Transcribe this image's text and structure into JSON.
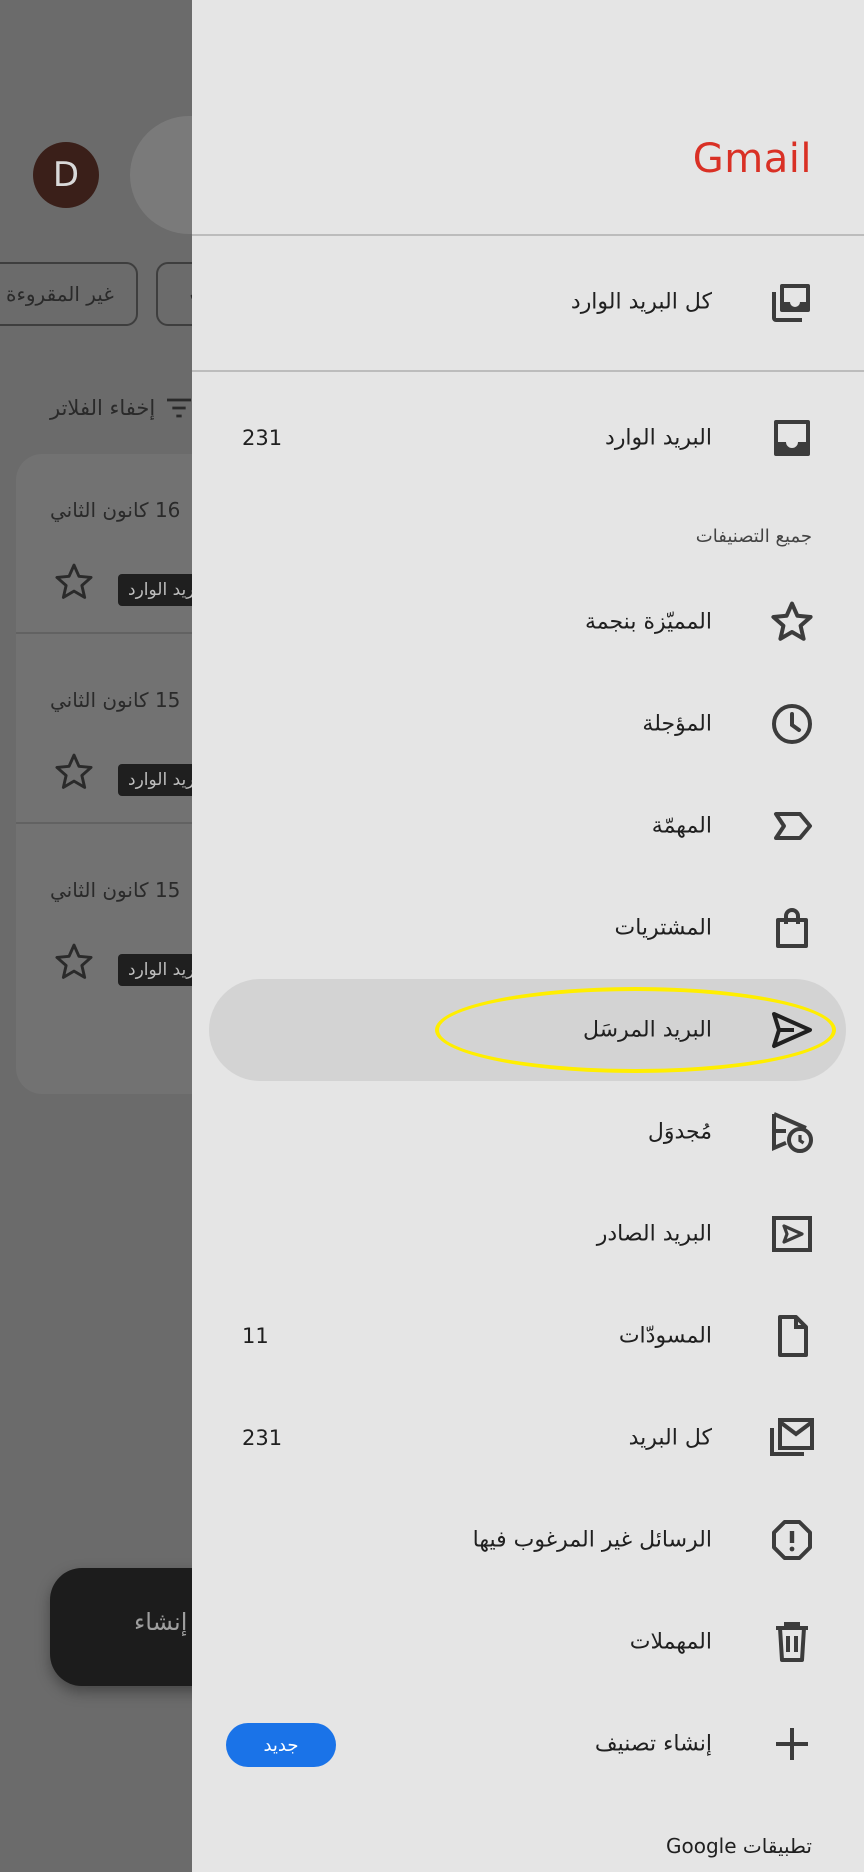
{
  "background": {
    "avatar_letter": "D",
    "chips": [
      "غير المقروءة",
      "✓"
    ],
    "filters_label": "إخفاء الفلاتر",
    "emails": [
      {
        "date": "16 كانون الثاني",
        "label": "البريد الوارد"
      },
      {
        "date": "15 كانون الثاني",
        "label": "البريد الوارد"
      },
      {
        "date": "15 كانون الثاني",
        "label": "البريد الوارد"
      }
    ],
    "compose_label": "إنشاء"
  },
  "drawer": {
    "logo": "Gmail",
    "all_inboxes": {
      "label": "كل البريد الوارد",
      "icon": "all-inboxes-icon"
    },
    "inbox": {
      "label": "البريد الوارد",
      "count": "231",
      "icon": "inbox-icon"
    },
    "section_title": "جميع التصنيفات",
    "items": [
      {
        "label": "المميّزة بنجمة",
        "count": "",
        "icon": "star-icon"
      },
      {
        "label": "المؤجلة",
        "count": "",
        "icon": "clock-icon"
      },
      {
        "label": "المهمّة",
        "count": "",
        "icon": "important-icon"
      },
      {
        "label": "المشتريات",
        "count": "",
        "icon": "shopping-bag-icon"
      },
      {
        "label": "البريد المرسَل",
        "count": "",
        "icon": "send-icon",
        "selected": true
      },
      {
        "label": "مُجدوَل",
        "count": "",
        "icon": "scheduled-send-icon"
      },
      {
        "label": "البريد الصادر",
        "count": "",
        "icon": "outbox-icon"
      },
      {
        "label": "المسودّات",
        "count": "11",
        "icon": "draft-icon"
      },
      {
        "label": "كل البريد",
        "count": "231",
        "icon": "all-mail-icon"
      },
      {
        "label": "الرسائل غير المرغوب فيها",
        "count": "",
        "icon": "spam-icon"
      },
      {
        "label": "المهملات",
        "count": "",
        "icon": "trash-icon"
      }
    ],
    "create_label": {
      "label": "إنشاء تصنيف",
      "badge": "جديد",
      "icon": "plus-icon"
    },
    "google_apps": "تطبيقات Google"
  },
  "colors": {
    "gmail_red": "#d93025",
    "new_badge_blue": "#1a73e8",
    "highlight_yellow": "#ffee00"
  }
}
